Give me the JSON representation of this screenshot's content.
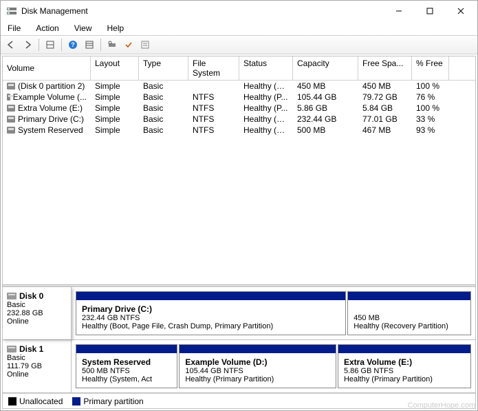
{
  "window": {
    "title": "Disk Management"
  },
  "menu": {
    "file": "File",
    "action": "Action",
    "view": "View",
    "help": "Help"
  },
  "columns": [
    "Volume",
    "Layout",
    "Type",
    "File System",
    "Status",
    "Capacity",
    "Free Spa...",
    "% Free"
  ],
  "volumes": [
    {
      "name": "(Disk 0 partition 2)",
      "layout": "Simple",
      "type": "Basic",
      "fs": "",
      "status": "Healthy (R...",
      "capacity": "450 MB",
      "free": "450 MB",
      "pct": "100 %"
    },
    {
      "name": "Example Volume (...",
      "layout": "Simple",
      "type": "Basic",
      "fs": "NTFS",
      "status": "Healthy (P...",
      "capacity": "105.44 GB",
      "free": "79.72 GB",
      "pct": "76 %"
    },
    {
      "name": "Extra Volume (E:)",
      "layout": "Simple",
      "type": "Basic",
      "fs": "NTFS",
      "status": "Healthy (P...",
      "capacity": "5.86 GB",
      "free": "5.84 GB",
      "pct": "100 %"
    },
    {
      "name": "Primary Drive (C:)",
      "layout": "Simple",
      "type": "Basic",
      "fs": "NTFS",
      "status": "Healthy (B...",
      "capacity": "232.44 GB",
      "free": "77.01 GB",
      "pct": "33 %"
    },
    {
      "name": "System Reserved",
      "layout": "Simple",
      "type": "Basic",
      "fs": "NTFS",
      "status": "Healthy (S...",
      "capacity": "500 MB",
      "free": "467 MB",
      "pct": "93 %"
    }
  ],
  "disks": [
    {
      "name": "Disk 0",
      "type": "Basic",
      "size": "232.88 GB",
      "status": "Online",
      "partitions": [
        {
          "label": "Primary Drive  (C:)",
          "size": "232.44 GB NTFS",
          "status": "Healthy (Boot, Page File, Crash Dump, Primary Partition)",
          "grow": 80
        },
        {
          "label": "",
          "size": "450 MB",
          "status": "Healthy (Recovery Partition)",
          "grow": 20
        }
      ]
    },
    {
      "name": "Disk 1",
      "type": "Basic",
      "size": "111.79 GB",
      "status": "Online",
      "partitions": [
        {
          "label": "System Reserved",
          "size": "500 MB NTFS",
          "status": "Healthy (System, Act",
          "grow": 18
        },
        {
          "label": "Example Volume  (D:)",
          "size": "105.44 GB NTFS",
          "status": "Healthy (Primary Partition)",
          "grow": 52
        },
        {
          "label": "Extra Volume  (E:)",
          "size": "5.86 GB NTFS",
          "status": "Healthy (Primary Partition)",
          "grow": 30
        }
      ]
    }
  ],
  "legend": {
    "unallocated": "Unallocated",
    "primary": "Primary partition"
  },
  "colors": {
    "primary": "#001b8a",
    "unallocated": "#000000"
  },
  "watermark": "ComputerHope.com"
}
